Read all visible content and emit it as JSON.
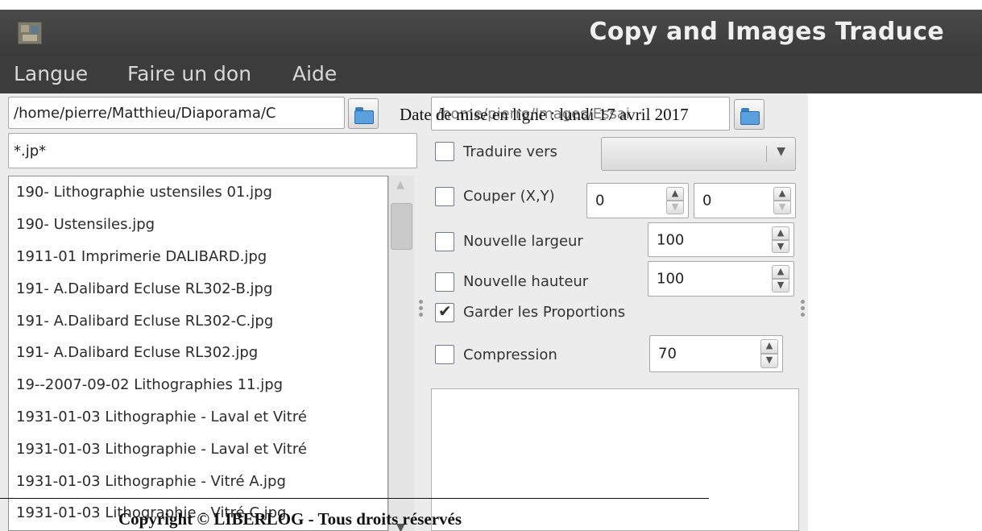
{
  "window": {
    "title": "Copy and Images Traduce",
    "icon": "app-picture-icon"
  },
  "menu": [
    "Langue",
    "Faire un don",
    "Aide"
  ],
  "source": {
    "path_value": "/home/pierre/Matthieu/Diaporama/C",
    "filter_value": "*.jp*",
    "browse_icon": "folder-icon"
  },
  "destination": {
    "path_value": "/home/pierre/Images/Essai",
    "browse_icon": "folder-icon"
  },
  "files": [
    "190- Lithographie ustensiles 01.jpg",
    "190- Ustensiles.jpg",
    "1911-01 Imprimerie DALIBARD.jpg",
    "191- A.Dalibard Ecluse RL302-B.jpg",
    "191- A.Dalibard Ecluse RL302-C.jpg",
    "191- A.Dalibard Ecluse RL302.jpg",
    "19--2007-09-02 Lithographies 11.jpg",
    "1931-01-03 Lithographie - Laval et Vitré",
    "1931-01-03 Lithographie - Laval et Vitré",
    "1931-01-03 Lithographie - Vitré A.jpg",
    "1931-01-03 Lithographie - Vitré C.jpg"
  ],
  "options": {
    "translate": {
      "label": "Traduire vers",
      "checked": false,
      "selected": ""
    },
    "crop": {
      "label": "Couper (X,Y)",
      "checked": false,
      "x": "0",
      "y": "0"
    },
    "width": {
      "label": "Nouvelle largeur",
      "checked": false,
      "value": "100"
    },
    "height": {
      "label": "Nouvelle hauteur",
      "checked": false,
      "value": "100"
    },
    "keep_ratio": {
      "label": "Garder les Proportions",
      "checked": true,
      "mark": "✔"
    },
    "compression": {
      "label": "Compression",
      "checked": false,
      "value": "70"
    }
  },
  "overlay": {
    "date": "Date de mise en ligne : lundi 17 avril 2017",
    "copyright": "Copyright © LIBERLOG - Tous droits réservés"
  },
  "colors": {
    "titlebar": "#3f3f3f",
    "menubar": "#3c3c3c",
    "panel": "#ececec"
  }
}
